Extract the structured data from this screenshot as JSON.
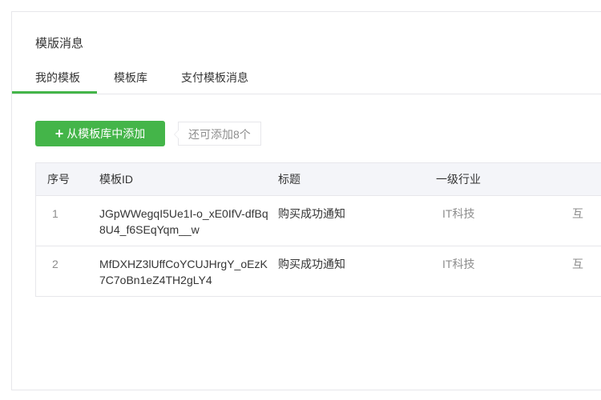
{
  "page": {
    "title": "模版消息"
  },
  "tabs": [
    {
      "label": "我的模板",
      "active": true
    },
    {
      "label": "模板库",
      "active": false
    },
    {
      "label": "支付模板消息",
      "active": false
    }
  ],
  "toolbar": {
    "add_label": "从模板库中添加",
    "quota_text": "还可添加8个"
  },
  "table": {
    "headers": [
      "序号",
      "模板ID",
      "标题",
      "一级行业",
      ""
    ],
    "rows": [
      {
        "index": "1",
        "template_id": "JGpWWegqI5Ue1I-o_xE0IfV-dfBq8U4_f6SEqYqm__w",
        "title": "购买成功通知",
        "industry": "IT科技",
        "sub_industry": "互"
      },
      {
        "index": "2",
        "template_id": "MfDXHZ3lUffCoYCUJHrgY_oEzK7C7oBn1eZ4TH2gLY4",
        "title": "购买成功通知",
        "industry": "IT科技",
        "sub_industry": "互"
      }
    ]
  },
  "colors": {
    "accent": "#44b549",
    "border": "#e7e7eb",
    "header_bg": "#f4f5f9"
  }
}
